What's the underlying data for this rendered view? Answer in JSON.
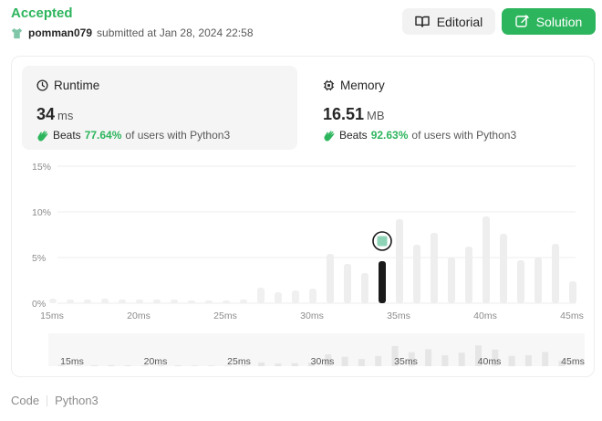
{
  "submission": {
    "status": "Accepted",
    "username": "pomman079",
    "submitted_text": "submitted at Jan 28, 2024 22:58"
  },
  "actions": {
    "editorial_label": "Editorial",
    "solution_label": "Solution"
  },
  "runtime": {
    "title": "Runtime",
    "value": "34",
    "unit": "ms",
    "beats_label": "Beats",
    "beats_pct": "77.64%",
    "beats_suffix": "of users with Python3"
  },
  "memory": {
    "title": "Memory",
    "value": "16.51",
    "unit": "MB",
    "beats_label": "Beats",
    "beats_pct": "92.63%",
    "beats_suffix": "of users with Python3"
  },
  "footer": {
    "code_label": "Code",
    "language": "Python3"
  },
  "colors": {
    "accent_green": "#2db55d",
    "bar_gray": "#eeeeee",
    "bar_selected": "#1a1a1a",
    "marker_fill": "#8fd3b6"
  },
  "chart_data": {
    "type": "bar",
    "ylabel_ticks": [
      "0%",
      "5%",
      "10%",
      "15%"
    ],
    "xtick_labels": [
      "15ms",
      "20ms",
      "25ms",
      "30ms",
      "35ms",
      "40ms",
      "45ms"
    ],
    "ylim": [
      0,
      15
    ],
    "xlim": [
      15,
      45
    ],
    "x": [
      15,
      16,
      17,
      18,
      19,
      20,
      21,
      22,
      23,
      24,
      25,
      26,
      27,
      28,
      29,
      30,
      31,
      32,
      33,
      34,
      35,
      36,
      37,
      38,
      39,
      40,
      41,
      42,
      43,
      44,
      45
    ],
    "values": [
      0.5,
      0.4,
      0.4,
      0.5,
      0.4,
      0.4,
      0.4,
      0.4,
      0.3,
      0.3,
      0.3,
      0.4,
      1.7,
      1.2,
      1.4,
      1.6,
      5.4,
      4.3,
      3.3,
      4.4,
      9.2,
      6.4,
      7.7,
      5.0,
      6.2,
      9.5,
      7.6,
      4.7,
      5.0,
      6.5,
      2.4
    ],
    "selected_x": 34,
    "selected_value": 4.6,
    "grid": true
  }
}
